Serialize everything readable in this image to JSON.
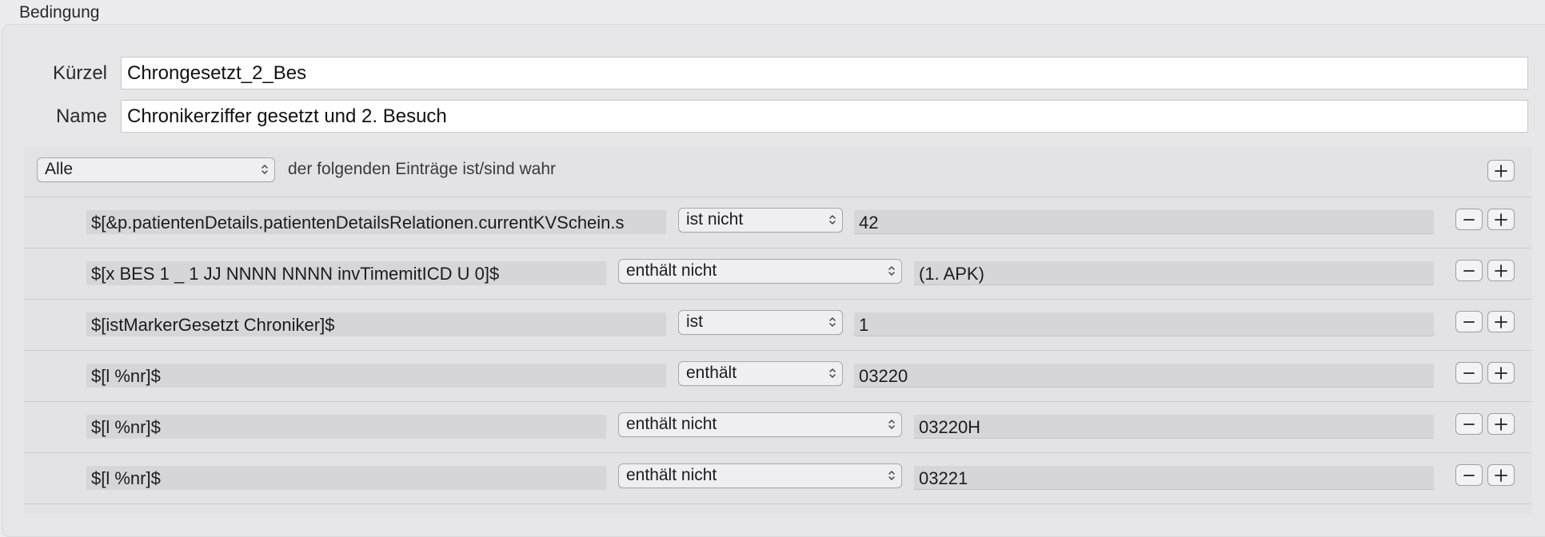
{
  "section_title": "Bedingung",
  "fields": {
    "kuerzel_label": "Kürzel",
    "kuerzel_value": "Chrongesetzt_2_Bes",
    "name_label": "Name",
    "name_value": "Chronikerziffer gesetzt und 2. Besuch"
  },
  "header": {
    "match_selector": "Alle",
    "match_text": "der folgenden Einträge ist/sind wahr"
  },
  "rows": [
    {
      "key": "$[&p.patientenDetails.patientenDetailsRelationen.currentKVSchein.s",
      "operator": "ist nicht",
      "value": "42"
    },
    {
      "key": "$[x BES 1 _ 1 JJ NNNN NNNN invTimemitICD U 0]$",
      "operator": "enthält nicht",
      "value": "(1. APK)"
    },
    {
      "key": "$[istMarkerGesetzt Chroniker]$",
      "operator": "ist",
      "value": "1"
    },
    {
      "key": "$[l %nr]$",
      "operator": "enthält",
      "value": "03220"
    },
    {
      "key": "$[l %nr]$",
      "operator": "enthält nicht",
      "value": "03220H"
    },
    {
      "key": "$[l %nr]$",
      "operator": "enthält nicht",
      "value": "03221"
    }
  ],
  "icons": {
    "add": "plus-icon",
    "remove": "minus-icon",
    "popup_arrows": "chevron-updown-icon"
  }
}
